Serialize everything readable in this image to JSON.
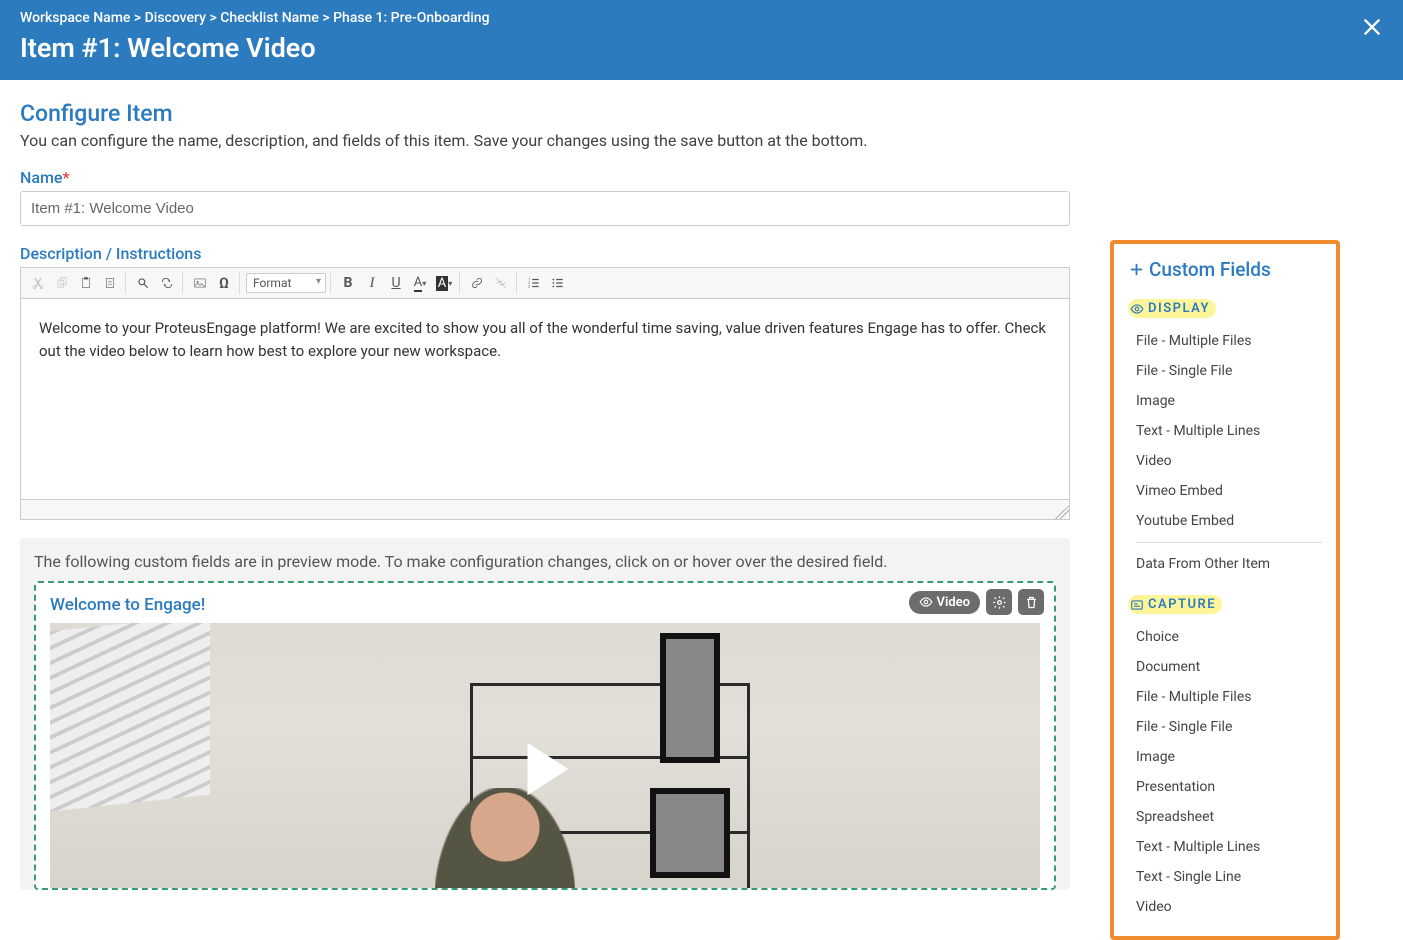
{
  "header": {
    "breadcrumb": "Workspace Name > Discovery > Checklist Name > Phase 1: Pre-Onboarding",
    "title": "Item #1: Welcome Video"
  },
  "configure": {
    "heading": "Configure Item",
    "description": "You can configure the name, description, and fields of this item. Save your changes using the save button at the bottom.",
    "name_label": "Name",
    "name_value": "Item #1: Welcome Video",
    "desc_label": "Description / Instructions"
  },
  "editor": {
    "format_label": "Format",
    "body": "Welcome to your ProteusEngage platform! We are excited to show you all of the wonderful time saving, value driven features Engage has to offer. Check out the video below to learn how best to explore your new workspace."
  },
  "preview": {
    "note": "The following custom fields are in preview mode. To make configuration changes, click on or hover over the desired field.",
    "field_title": "Welcome to Engage!",
    "badge_label": "Video"
  },
  "sidebar": {
    "title": "Custom Fields",
    "group_display": "DISPLAY",
    "group_capture": "CAPTURE",
    "display_items": [
      "File - Multiple Files",
      "File - Single File",
      "Image",
      "Text - Multiple Lines",
      "Video",
      "Vimeo Embed",
      "Youtube Embed"
    ],
    "display_extra": "Data From Other Item",
    "capture_items": [
      "Choice",
      "Document",
      "File - Multiple Files",
      "File - Single File",
      "Image",
      "Presentation",
      "Spreadsheet",
      "Text - Multiple Lines",
      "Text - Single Line",
      "Video"
    ]
  }
}
